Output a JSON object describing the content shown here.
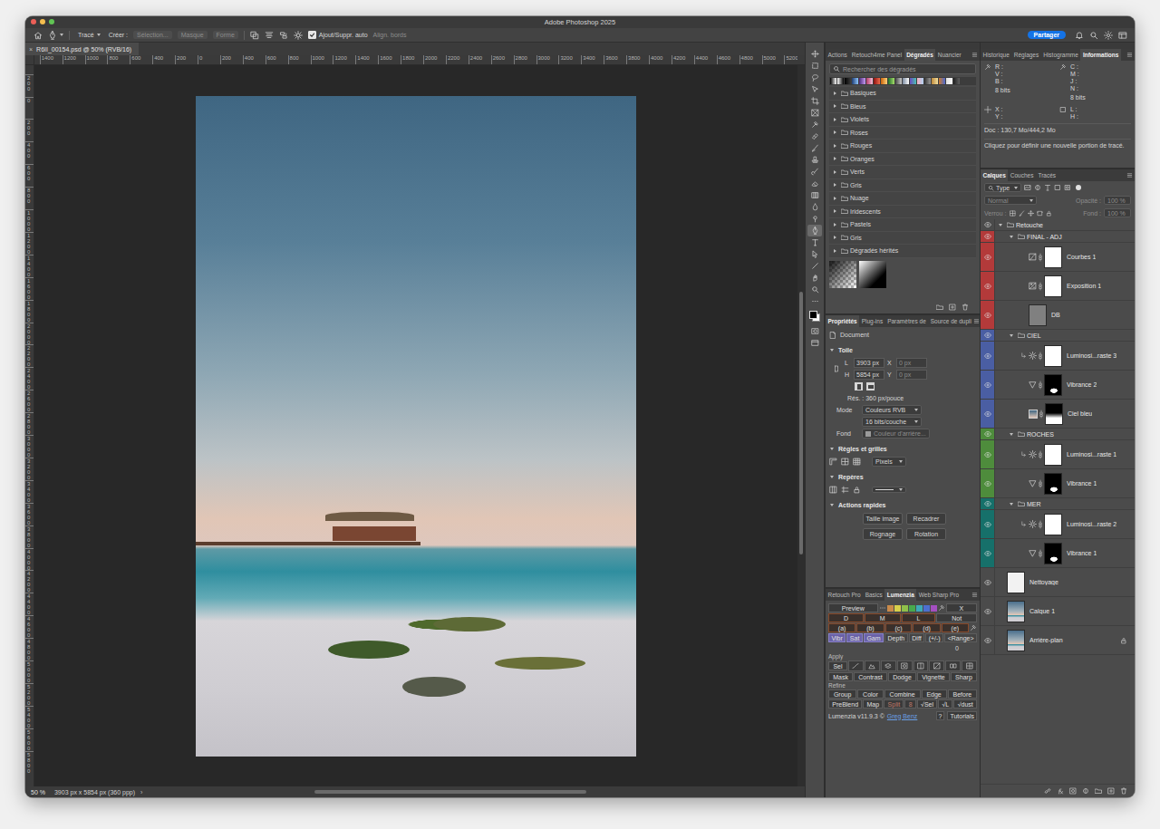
{
  "window": {
    "title": "Adobe Photoshop 2025"
  },
  "options_bar": {
    "mode": "Tracé",
    "create_label": "Créer :",
    "create_buttons": [
      {
        "label": "Sélection...",
        "disabled": true
      },
      {
        "label": "Masque",
        "disabled": true
      },
      {
        "label": "Forme",
        "disabled": true
      }
    ],
    "auto_add": {
      "label": "Ajout/Suppr. auto",
      "checked": true
    },
    "align_edges": {
      "label": "Align. bords",
      "disabled": true
    },
    "share": "Partager"
  },
  "document": {
    "close": "×",
    "tab": "R6II_00154.psd @ 50% (RVB/16)"
  },
  "rulers": {
    "top": [
      "1400",
      "1200",
      "1000",
      "800",
      "600",
      "400",
      "200",
      "0",
      "200",
      "400",
      "600",
      "800",
      "1000",
      "1200",
      "1400",
      "1600",
      "1800",
      "2000",
      "2200",
      "2400",
      "2600",
      "2800",
      "3000",
      "3200",
      "3400",
      "3600",
      "3800",
      "4000",
      "4200",
      "4400",
      "4600",
      "4800",
      "5000",
      "5200"
    ],
    "left": [
      "200",
      "0",
      "200",
      "400",
      "600",
      "800",
      "1000",
      "1200",
      "1400",
      "1600",
      "1800",
      "2000",
      "2200",
      "2400",
      "2600",
      "2800",
      "3000",
      "3200",
      "3400",
      "3600",
      "3800",
      "4000",
      "4200",
      "4400",
      "4600",
      "4800",
      "5000",
      "5200",
      "5400",
      "5600",
      "5800"
    ]
  },
  "status_bar": {
    "zoom": "50 %",
    "info": "3903 px x 5854 px (360 ppp)",
    "more": "›"
  },
  "tools": [
    {
      "kind": "move",
      "selected": false
    },
    {
      "kind": "marquee",
      "selected": false
    },
    {
      "kind": "lasso",
      "selected": false
    },
    {
      "kind": "select",
      "selected": false
    },
    {
      "kind": "crop",
      "selected": false
    },
    {
      "kind": "frame",
      "selected": false
    },
    {
      "kind": "eyedropper",
      "selected": false
    },
    {
      "kind": "heal",
      "selected": false
    },
    {
      "kind": "brush",
      "selected": false
    },
    {
      "kind": "stamp",
      "selected": false
    },
    {
      "kind": "history",
      "selected": false
    },
    {
      "kind": "eraser",
      "selected": false
    },
    {
      "kind": "gradient",
      "selected": false
    },
    {
      "kind": "blur",
      "selected": false
    },
    {
      "kind": "dodge",
      "selected": false
    },
    {
      "kind": "pen",
      "selected": true
    },
    {
      "kind": "type",
      "selected": false
    },
    {
      "kind": "path",
      "selected": false
    },
    {
      "kind": "line",
      "selected": false
    },
    {
      "kind": "hand",
      "selected": false
    },
    {
      "kind": "zoom",
      "selected": false
    },
    {
      "kind": "more",
      "selected": false
    },
    {
      "kind": "colors",
      "selected": false
    },
    {
      "kind": "quickmask",
      "selected": false
    },
    {
      "kind": "screen",
      "selected": false
    }
  ],
  "gradients": {
    "tabs": [
      {
        "label": "Actions",
        "selected": false
      },
      {
        "label": "Retouch4me Panel",
        "selected": false
      },
      {
        "label": "Dégradés",
        "selected": true
      },
      {
        "label": "Nuancier",
        "selected": false
      }
    ],
    "search": {
      "placeholder": "Rechercher des dégradés"
    },
    "folders": [
      {
        "label": "Basiques",
        "expanded": false
      },
      {
        "label": "Bleus",
        "expanded": false
      },
      {
        "label": "Violets",
        "expanded": false
      },
      {
        "label": "Roses",
        "expanded": false
      },
      {
        "label": "Rouges",
        "expanded": false
      },
      {
        "label": "Oranges",
        "expanded": false
      },
      {
        "label": "Verts",
        "expanded": false
      },
      {
        "label": "Gris",
        "expanded": false
      },
      {
        "label": "Nuage",
        "expanded": false
      },
      {
        "label": "Iridescents",
        "expanded": false
      },
      {
        "label": "Pastels",
        "expanded": false
      },
      {
        "label": "Gris",
        "expanded": false
      },
      {
        "label": "Dégradés hérités",
        "expanded": false
      }
    ]
  },
  "properties": {
    "tabs": [
      {
        "label": "Propriétés",
        "selected": true
      },
      {
        "label": "Plug-ins",
        "selected": false
      },
      {
        "label": "Paramètres de",
        "selected": false
      },
      {
        "label": "Source de dupli",
        "selected": false
      }
    ],
    "document": "Document",
    "canvas": {
      "title": "Toile",
      "expanded": true,
      "w_label": "L",
      "w": "3903 px",
      "x_label": "X",
      "x": "0 px",
      "h_label": "H",
      "h": "5854 px",
      "y_label": "Y",
      "y": "0 px",
      "resolution": "Rés. : 360 px/pouce",
      "mode_label": "Mode",
      "mode": "Couleurs RVB",
      "depth": "16 bits/couche",
      "fill_label": "Fond",
      "fill": "Couleur d'arrière..."
    },
    "rulers": {
      "title": "Règles et grilles",
      "expanded": true,
      "unit": "Pixels"
    },
    "guides": {
      "title": "Repères",
      "expanded": true
    },
    "quick_actions": {
      "title": "Actions rapides",
      "expanded": true,
      "buttons": [
        "Taille image",
        "Recadrer",
        "Rognage",
        "Rotation"
      ]
    }
  },
  "lumenzia": {
    "tabs": [
      {
        "label": "Retouch Pro",
        "selected": false
      },
      {
        "label": "Basics",
        "selected": false
      },
      {
        "label": "Lumenzia",
        "selected": true
      },
      {
        "label": "Web Sharp Pro",
        "selected": false
      }
    ],
    "preview": "Preview",
    "swatches": [
      {
        "color": "#c98a4a"
      },
      {
        "color": "#d7cf4a"
      },
      {
        "color": "#8fbf4a"
      },
      {
        "color": "#47a94d"
      },
      {
        "color": "#3fa9b8"
      },
      {
        "color": "#4d6fd0"
      },
      {
        "color": "#a44fc0"
      }
    ],
    "close": "X",
    "zones": [
      {
        "label": "D",
        "selected": false
      },
      {
        "label": "M",
        "selected": false
      },
      {
        "label": "L",
        "selected": false
      }
    ],
    "not": "Not",
    "letters": [
      {
        "label": "(a)",
        "selected": false
      },
      {
        "label": "(b)",
        "selected": false
      },
      {
        "label": "(c)",
        "selected": false
      },
      {
        "label": "(d)",
        "selected": false
      },
      {
        "label": "(e)",
        "selected": false
      }
    ],
    "modes": [
      {
        "label": "Vibr",
        "selected": true
      },
      {
        "label": "Sat",
        "selected": true
      },
      {
        "label": "Gam",
        "selected": true
      }
    ],
    "options": [
      "Depth",
      "Diff",
      "(+/-)",
      "<Range>"
    ],
    "value": "0",
    "apply_label": "Apply",
    "apply_sel": "Sel",
    "apply_icons": [
      {
        "kind": "curve"
      },
      {
        "kind": "levels"
      },
      {
        "kind": "layer"
      },
      {
        "kind": "mask"
      },
      {
        "kind": "split"
      },
      {
        "kind": "grad"
      },
      {
        "kind": "dual"
      },
      {
        "kind": "grid"
      }
    ],
    "apply_buttons": [
      "Mask",
      "Contrast",
      "Dodge",
      "Vignette",
      "Sharp"
    ],
    "refine_label": "Refine",
    "refine_buttons": [
      "Group",
      "Color",
      "Combine",
      "Edge",
      "Before"
    ],
    "refine_extra": [
      {
        "label": "PreBlend",
        "disabled": false
      },
      {
        "label": "Map",
        "disabled": false
      },
      {
        "label": "Split",
        "disabled": true
      },
      {
        "label": "8",
        "disabled": true
      },
      {
        "label": "√Sel",
        "disabled": false
      },
      {
        "label": "√L",
        "disabled": false
      },
      {
        "label": "√dust",
        "disabled": false
      }
    ],
    "footer": {
      "version": "Lumenzia v11.9.3 ©",
      "author": "Greg Benz",
      "help": "?",
      "tutorials": "Tutorials"
    }
  },
  "info": {
    "tabs": [
      {
        "label": "Historique",
        "selected": false
      },
      {
        "label": "Réglages",
        "selected": false
      },
      {
        "label": "Histogramme",
        "selected": false
      },
      {
        "label": "Informations",
        "selected": true
      }
    ],
    "rgb": [
      "R :",
      "V :",
      "B :"
    ],
    "rgb_depth": "8 bits",
    "cmyk": [
      "C :",
      "M :",
      "J :",
      "N :"
    ],
    "cmyk_depth": "8 bits",
    "xy": [
      "X :",
      "Y :"
    ],
    "wh": [
      "L :",
      "H :"
    ],
    "doc": "Doc : 130,7 Mo/444,2 Mo",
    "hint": "Cliquez pour définir une nouvelle portion de tracé."
  },
  "layers": {
    "tabs": [
      {
        "label": "Calques",
        "selected": true
      },
      {
        "label": "Couches",
        "selected": false
      },
      {
        "label": "Tracés",
        "selected": false
      }
    ],
    "filter": "Type",
    "blend": "Normal",
    "opacity_label": "Opacité :",
    "opacity": "100 %",
    "lock_label": "Verrou :",
    "fill_label": "Fond :",
    "fill": "100 %",
    "disabled": true,
    "items": [
      {
        "name": "Retouche",
        "kind": "group",
        "depth": 0,
        "expanded": true,
        "visible": true,
        "color": null,
        "clipped": false,
        "mask": null,
        "underlined": false,
        "locked": false
      },
      {
        "name": "FINAL - ADJ",
        "kind": "group",
        "depth": 1,
        "expanded": true,
        "visible": true,
        "color": "#b33a3a",
        "clipped": false,
        "mask": null,
        "underlined": false,
        "locked": false
      },
      {
        "name": "Courbes 1",
        "kind": "curves",
        "depth": 2,
        "expanded": false,
        "visible": true,
        "color": "#b33a3a",
        "clipped": false,
        "mask": "white",
        "underlined": false,
        "locked": false
      },
      {
        "name": "Exposition 1",
        "kind": "exposure",
        "depth": 2,
        "expanded": false,
        "visible": true,
        "color": "#b33a3a",
        "clipped": false,
        "mask": "white",
        "underlined": false,
        "locked": false
      },
      {
        "name": "DB",
        "kind": "gray-fill",
        "depth": 2,
        "expanded": false,
        "visible": true,
        "color": "#b33a3a",
        "clipped": false,
        "mask": null,
        "underlined": false,
        "locked": false
      },
      {
        "name": "CIEL",
        "kind": "group",
        "depth": 1,
        "expanded": true,
        "visible": true,
        "color": "#4a5ea3",
        "clipped": false,
        "mask": null,
        "underlined": false,
        "locked": false
      },
      {
        "name": "Luminosi...raste 3",
        "kind": "luminosity",
        "depth": 2,
        "expanded": false,
        "visible": true,
        "color": "#4a5ea3",
        "clipped": true,
        "mask": "white",
        "underlined": false,
        "locked": false
      },
      {
        "name": "Vibrance 2",
        "kind": "vibrance",
        "depth": 2,
        "expanded": false,
        "visible": true,
        "color": "#4a5ea3",
        "clipped": false,
        "mask": "mixed",
        "underlined": true,
        "locked": false
      },
      {
        "name": "Ciel bleu",
        "kind": "gradient-fill",
        "depth": 2,
        "expanded": false,
        "visible": true,
        "color": "#4a5ea3",
        "clipped": false,
        "mask": "sky",
        "underlined": false,
        "locked": false
      },
      {
        "name": "ROCHES",
        "kind": "group",
        "depth": 1,
        "expanded": true,
        "visible": true,
        "color": "#4e8c3c",
        "clipped": false,
        "mask": null,
        "underlined": false,
        "locked": false
      },
      {
        "name": "Luminosi...raste 1",
        "kind": "luminosity",
        "depth": 2,
        "expanded": false,
        "visible": true,
        "color": "#4e8c3c",
        "clipped": true,
        "mask": "white",
        "underlined": false,
        "locked": false
      },
      {
        "name": "Vibrance 1",
        "kind": "vibrance",
        "depth": 2,
        "expanded": false,
        "visible": true,
        "color": "#4e8c3c",
        "clipped": false,
        "mask": "mixed",
        "underlined": true,
        "locked": false
      },
      {
        "name": "MER",
        "kind": "group",
        "depth": 1,
        "expanded": true,
        "visible": true,
        "color": "#16706a",
        "clipped": false,
        "mask": null,
        "underlined": false,
        "locked": false
      },
      {
        "name": "Luminosi...raste 2",
        "kind": "luminosity",
        "depth": 2,
        "expanded": false,
        "visible": true,
        "color": "#16706a",
        "clipped": true,
        "mask": "white",
        "underlined": false,
        "locked": false
      },
      {
        "name": "Vibrance 1",
        "kind": "vibrance",
        "depth": 2,
        "expanded": false,
        "visible": true,
        "color": "#16706a",
        "clipped": false,
        "mask": "mixed",
        "underlined": true,
        "locked": false
      },
      {
        "name": "Nettoyage",
        "kind": "white-layer",
        "depth": 0,
        "expanded": false,
        "visible": true,
        "color": null,
        "clipped": false,
        "mask": null,
        "underlined": false,
        "locked": false
      },
      {
        "name": "Calque 1",
        "kind": "photo",
        "depth": 0,
        "expanded": false,
        "visible": true,
        "color": null,
        "clipped": false,
        "mask": null,
        "underlined": false,
        "locked": false
      },
      {
        "name": "Arrière-plan",
        "kind": "photo",
        "depth": 0,
        "expanded": false,
        "visible": true,
        "color": null,
        "clipped": false,
        "mask": null,
        "underlined": false,
        "locked": true
      }
    ]
  }
}
